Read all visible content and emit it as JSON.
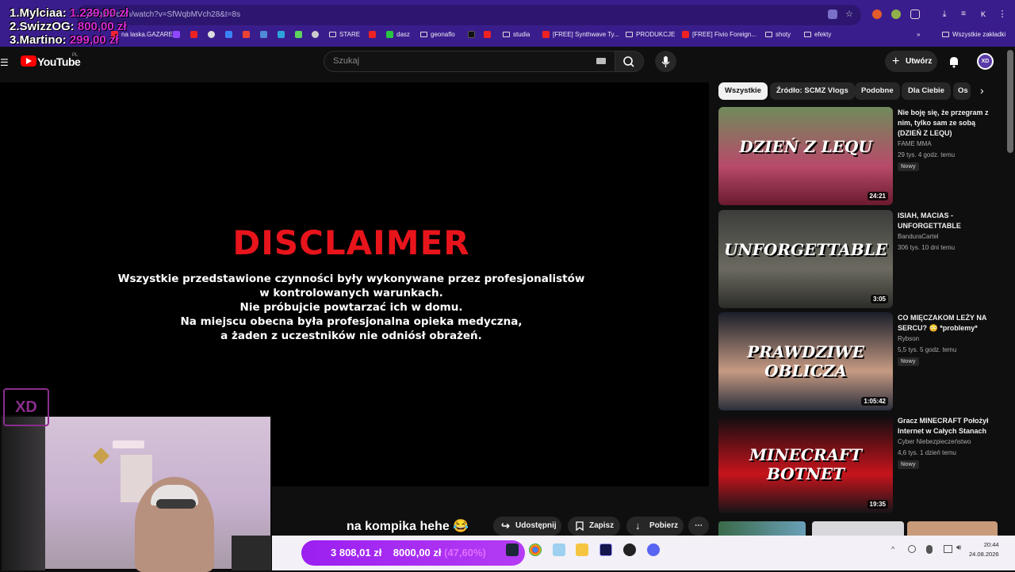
{
  "browser": {
    "url": "youtube.com/watch?v=SfWqbMVch28&t=8s",
    "bookmarks": [
      "na laska.GAZARE...",
      "STARE",
      "dasz",
      "geonaflo",
      "studia",
      "[FREE] Synthwave Ty...",
      "PRODUKCJE",
      "[FREE] Fivio Foreign...",
      "shoty",
      "efekty"
    ],
    "all_bookmarks": "Wszystkie zakładki",
    "profile_letter": "K"
  },
  "leaderboard": [
    {
      "name": "1.Mylciaa:",
      "amount": "1.239,00 zł"
    },
    {
      "name": "2.SwizzOG:",
      "amount": "800,00 zł"
    },
    {
      "name": "3.Martino:",
      "amount": "299,00 zł"
    }
  ],
  "youtube": {
    "logo_text": "YouTube",
    "country_code": "PL",
    "search_placeholder": "Szukaj",
    "create_label": "Utwórz",
    "avatar_text": "XD"
  },
  "video": {
    "disclaimer_title": "DISCLAIMER",
    "disclaimer_lines": [
      "Wszystkie przedstawione czynności były wykonywane przez profesjonalistów",
      "w kontrolowanych warunkach.",
      "Nie próbujcie powtarzać ich w domu.",
      "Na miejscu obecna była profesjonalna opieka medyczna,",
      "a żaden z uczestników nie odniósł obrażeń."
    ]
  },
  "actions": {
    "share": "Udostępnij",
    "save": "Zapisz",
    "download": "Pobierz",
    "more": "⋯"
  },
  "chips": [
    "Wszystkie",
    "Źródło: SCMZ Vlogs",
    "Podobne",
    "Dla Ciebie",
    "Os"
  ],
  "recommendations": [
    {
      "title": "Nie boję się, że przegram z nim, tylko sam ze sobą (DZIEŃ Z LEQU)",
      "channel": "FAME MMA",
      "views": "29 tys.",
      "age": "4 godz. temu",
      "badge": "Nowy",
      "duration": "24:21",
      "thumb_text": "DZIEŃ Z LEQU",
      "thumb_colors": [
        "#6f8b5b",
        "#b84a6a",
        "#6a1a2e"
      ]
    },
    {
      "title": "ISIAH, MACIAS - UNFORGETTABLE",
      "channel": "BanduraCartel",
      "views": "306 tys.",
      "age": "10 dni temu",
      "badge": "",
      "duration": "3:05",
      "thumb_text": "UNFORGETTABLE",
      "thumb_colors": [
        "#3b3d3a",
        "#6c6a60",
        "#2b2c28"
      ]
    },
    {
      "title": "CO MIĘCZAKOM LEŻY NA SERCU? 😳 *problemy*",
      "channel": "Rybson",
      "views": "5,5 tys.",
      "age": "5 godz. temu",
      "badge": "Nowy",
      "duration": "1:05:42",
      "thumb_text": "PRAWDZIWE OBLICZA",
      "thumb_colors": [
        "#1a1e2a",
        "#c69a82",
        "#2b2f3c"
      ]
    },
    {
      "title": "Gracz MINECRAFT Położył Internet w Całych Stanach",
      "channel": "Cyber Niebezpieczeństwo",
      "views": "4,6 tys.",
      "age": "1 dzień temu",
      "badge": "Nowy",
      "duration": "19:35",
      "thumb_text": "MINECRAFT BOTNET",
      "thumb_colors": [
        "#0d0d10",
        "#c8141c",
        "#141418"
      ]
    }
  ],
  "overlay": {
    "xd_logo": "XD",
    "subtitle": "na kompika hehe 😂",
    "goal_current": "3 808,01 zł",
    "goal_target": "8000,00 zł",
    "goal_pct": "(47,60%)"
  },
  "taskbar": {
    "time": "20:44",
    "date": "24.08.2026"
  },
  "colors": {
    "browser_bar": "#3a1d8c",
    "youtube_red": "#ff0000",
    "disclaimer_red": "#e8141c",
    "goal_purple": "#9b1ff0",
    "leaderboard_amount": "#d82bd8"
  }
}
